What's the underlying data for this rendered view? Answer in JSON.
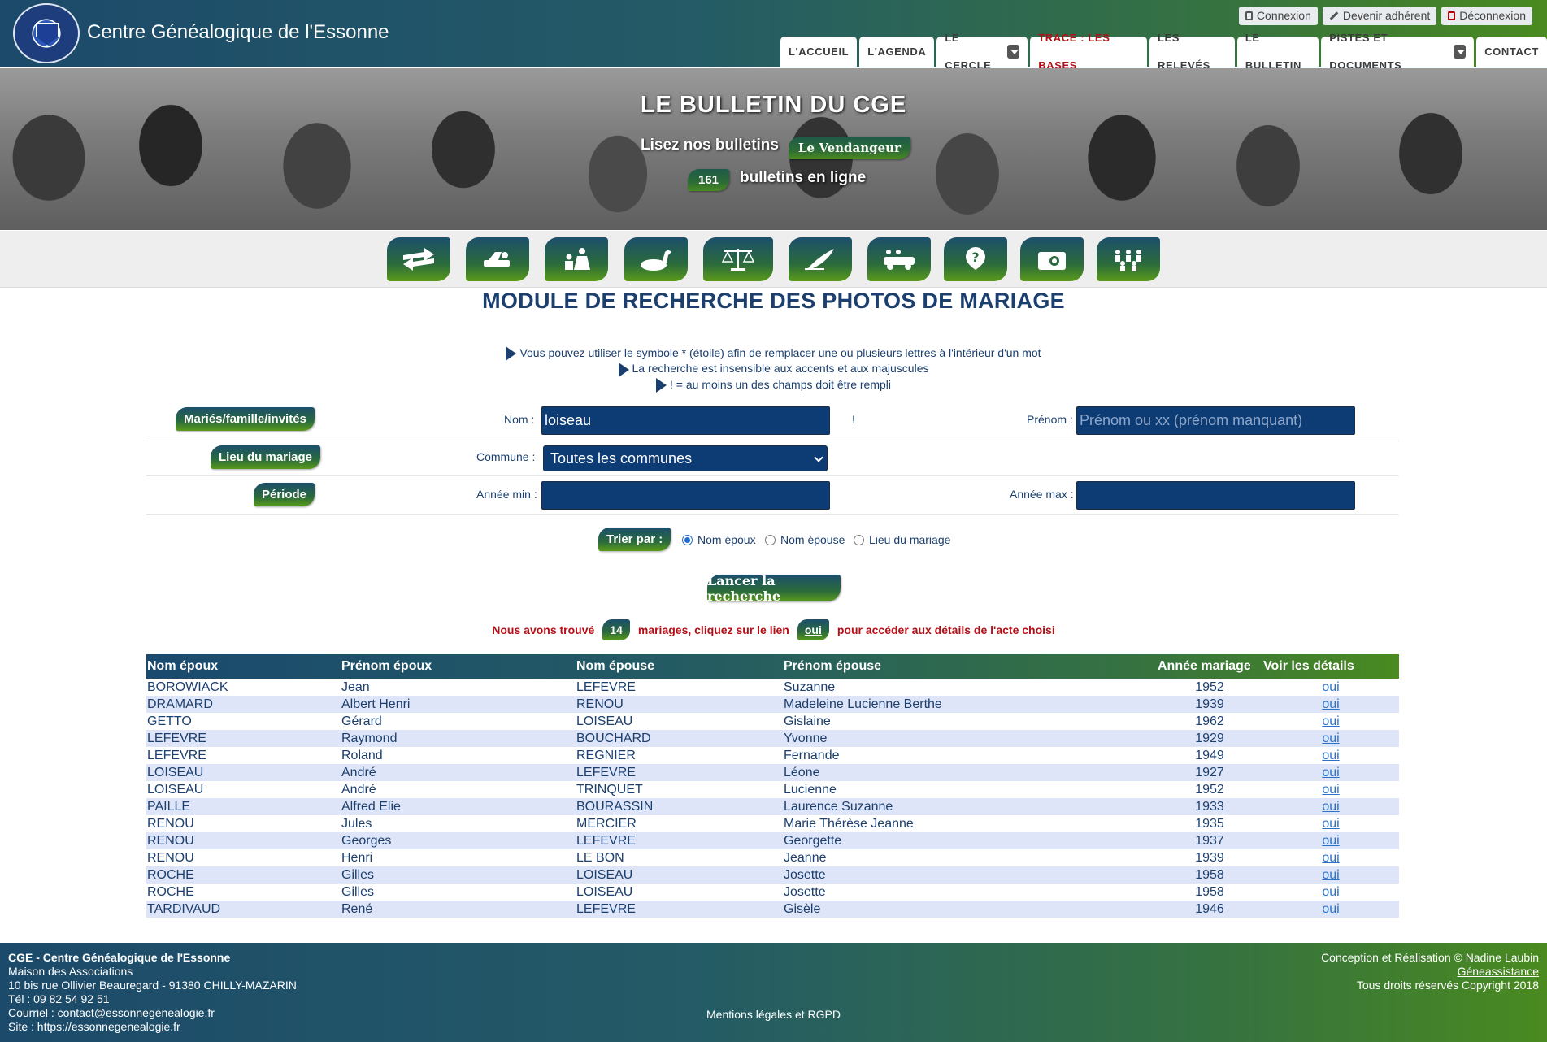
{
  "header": {
    "site_title": "Centre Généalogique de l'Essonne",
    "top_links": {
      "connexion": "Connexion",
      "devenir": "Devenir adhérent",
      "deconnexion": "Déconnexion"
    },
    "nav": [
      {
        "label": "L'ACCUEIL"
      },
      {
        "label": "L'AGENDA"
      },
      {
        "label": "LE CERCLE"
      },
      {
        "label": "TRACE : LES BASES"
      },
      {
        "label": "LES RELEVÉS"
      },
      {
        "label": "LE BULLETIN"
      },
      {
        "label": "PISTES ET DOCUMENTS"
      },
      {
        "label": "CONTACT"
      }
    ],
    "active_color": "#b31016"
  },
  "banner": {
    "title": "LE BULLETIN DU CGE",
    "line1": "Lisez nos bulletins",
    "pill": "Le Vendangeur",
    "count": "161",
    "line2": "bulletins en ligne"
  },
  "icons": [
    "arrows-icon",
    "plane-tool-icon",
    "family-icon",
    "duck-decoy-icon",
    "scales-icon",
    "quill-icon",
    "car-wedding-icon",
    "question-icon",
    "camera-icon",
    "group-icon"
  ],
  "page": {
    "title": "MODULE DE RECHERCHE DES PHOTOS DE MARIAGE",
    "tips": [
      "Vous pouvez utiliser le symbole * (étoile) afin de remplacer une ou plusieurs lettres à l'intérieur d'un mot",
      "La recherche est insensible aux accents et aux majuscules",
      "! = au moins un des champs doit être rempli"
    ]
  },
  "form": {
    "row1": {
      "badge": "Mariés/famille/invités",
      "nom_label": "Nom :",
      "nom_value": "loiseau",
      "required_mark": "!",
      "prenom_label": "Prénom :",
      "prenom_placeholder": "Prénom ou xx (prénom manquant)"
    },
    "row2": {
      "badge": "Lieu du mariage",
      "commune_label": "Commune :",
      "commune_value": "Toutes les communes"
    },
    "row3": {
      "badge": "Période",
      "min_label": "Année min :",
      "max_label": "Année max :"
    },
    "sort": {
      "badge": "Trier par :",
      "options": [
        "Nom époux",
        "Nom épouse",
        "Lieu du mariage"
      ],
      "selected": "Nom époux"
    },
    "search_button": "Lancer la recherche"
  },
  "results_summary": {
    "before": "Nous avons trouvé",
    "count": "14",
    "middle": "mariages, cliquez sur le lien",
    "link": "oui",
    "after": "pour accéder aux détails de l'acte choisi"
  },
  "table": {
    "headers": [
      "Nom époux",
      "Prénom époux",
      "Nom épouse",
      "Prénom épouse",
      "Année mariage",
      "Voir les détails"
    ],
    "rows": [
      [
        "BOROWIACK",
        "Jean",
        "LEFEVRE",
        "Suzanne",
        "1952",
        "oui"
      ],
      [
        "DRAMARD",
        "Albert Henri",
        "RENOU",
        "Madeleine Lucienne Berthe",
        "1939",
        "oui"
      ],
      [
        "GETTO",
        "Gérard",
        "LOISEAU",
        "Gislaine",
        "1962",
        "oui"
      ],
      [
        "LEFEVRE",
        "Raymond",
        "BOUCHARD",
        "Yvonne",
        "1929",
        "oui"
      ],
      [
        "LEFEVRE",
        "Roland",
        "REGNIER",
        "Fernande",
        "1949",
        "oui"
      ],
      [
        "LOISEAU",
        "André",
        "LEFEVRE",
        "Léone",
        "1927",
        "oui"
      ],
      [
        "LOISEAU",
        "André",
        "TRINQUET",
        "Lucienne",
        "1952",
        "oui"
      ],
      [
        "PAILLE",
        "Alfred Elie",
        "BOURASSIN",
        "Laurence Suzanne",
        "1933",
        "oui"
      ],
      [
        "RENOU",
        "Jules",
        "MERCIER",
        "Marie Thérèse Jeanne",
        "1935",
        "oui"
      ],
      [
        "RENOU",
        "Georges",
        "LEFEVRE",
        "Georgette",
        "1937",
        "oui"
      ],
      [
        "RENOU",
        "Henri",
        "LE BON",
        "Jeanne",
        "1939",
        "oui"
      ],
      [
        "ROCHE",
        "Gilles",
        "LOISEAU",
        "Josette",
        "1958",
        "oui"
      ],
      [
        "ROCHE",
        "Gilles",
        "LOISEAU",
        "Josette",
        "1958",
        "oui"
      ],
      [
        "TARDIVAUD",
        "René",
        "LEFEVRE",
        "Gisèle",
        "1946",
        "oui"
      ]
    ]
  },
  "footer": {
    "org": "CGE - Centre Généalogique de l'Essonne",
    "line1": "Maison des Associations",
    "line2": "10 bis rue Ollivier Beauregard - 91380 CHILLY-MAZARIN",
    "phone": "Tél : 09 82 54 92 51",
    "email": "Courriel : contact@essonnegenealogie.fr",
    "site": "Site : https://essonnegenealogie.fr",
    "center": "Mentions légales et RGPD",
    "credit": "Conception et Réalisation © Nadine Laubin",
    "credit_link": "Géneassistance",
    "copyright": "Tous droits réservés Copyright 2018"
  }
}
